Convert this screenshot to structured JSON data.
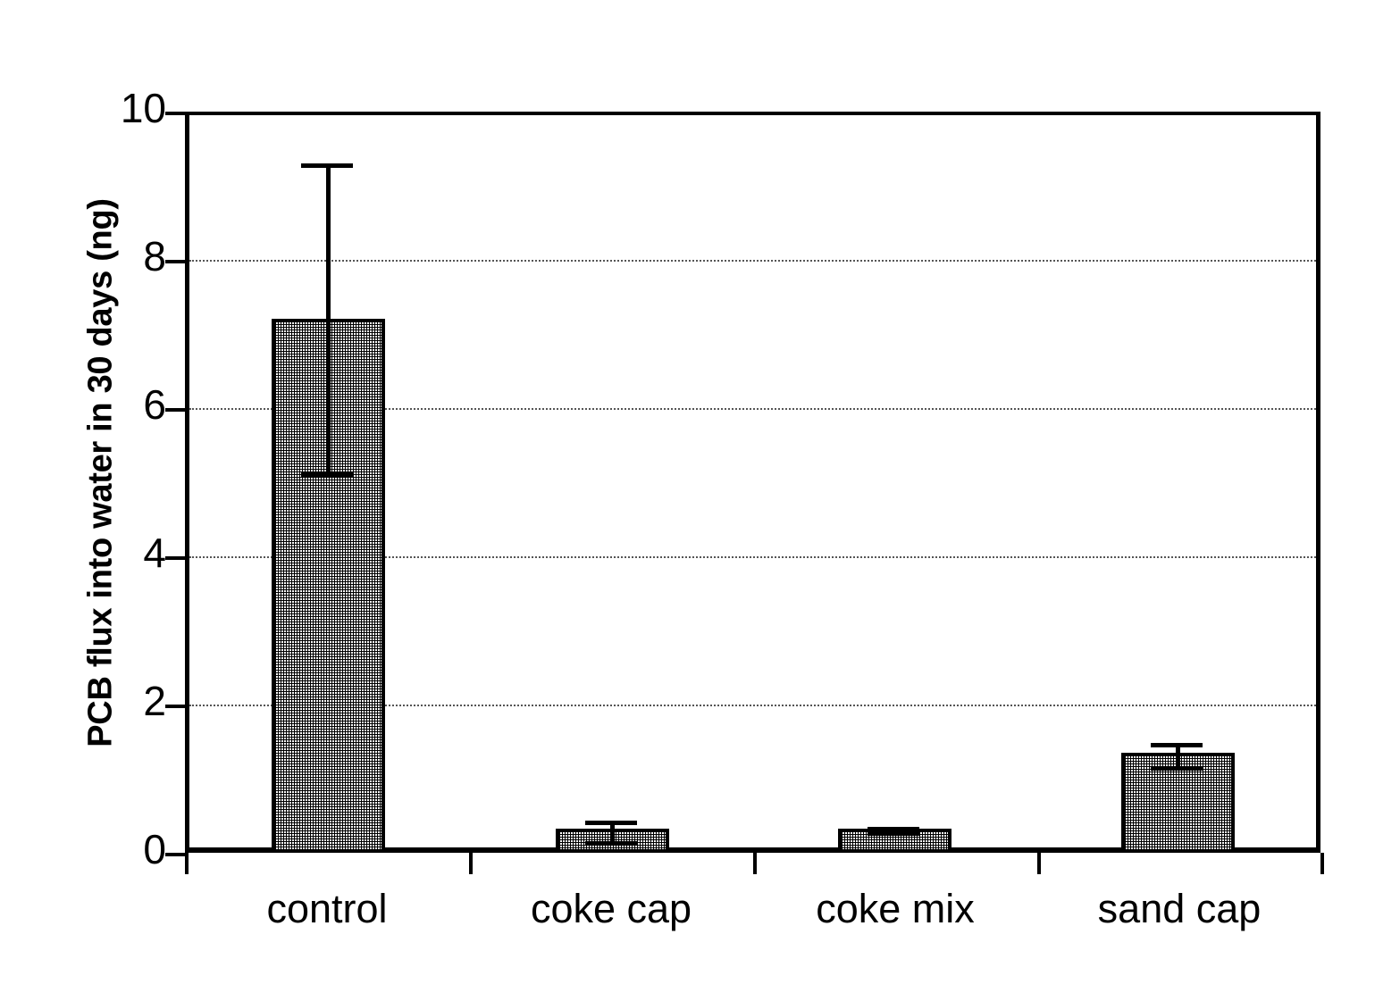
{
  "chart_data": {
    "type": "bar",
    "title": "",
    "subtitle": "",
    "xlabel": "",
    "ylabel": "PCB flux into water in 30 days (ng)",
    "categories": [
      "control",
      "coke cap",
      "coke mix",
      "sand cap"
    ],
    "values": [
      7.25,
      0.37,
      0.37,
      1.35
    ],
    "error_upper": [
      2.1,
      0.14,
      0.03,
      0.13
    ],
    "error_lower": [
      2.07,
      0.14,
      0.03,
      0.17
    ],
    "ylim": [
      0,
      10
    ],
    "yticks": [
      0,
      2,
      4,
      6,
      8,
      10
    ],
    "ytick_labels": [
      "0",
      "2",
      "4",
      "6",
      "8",
      "10"
    ],
    "grid": "horizontal-dotted",
    "legend": "none",
    "series_name": "PCB flux",
    "bar_fill": "gray-halftone-pattern",
    "bar_edge_color": "#000000"
  },
  "axes": {
    "y_title": "PCB flux into water in 30 days (ng)",
    "y_labels": [
      "10",
      "8",
      "6",
      "4",
      "2",
      "0"
    ],
    "x_labels": [
      "control",
      "coke cap",
      "coke mix",
      "sand cap"
    ]
  }
}
